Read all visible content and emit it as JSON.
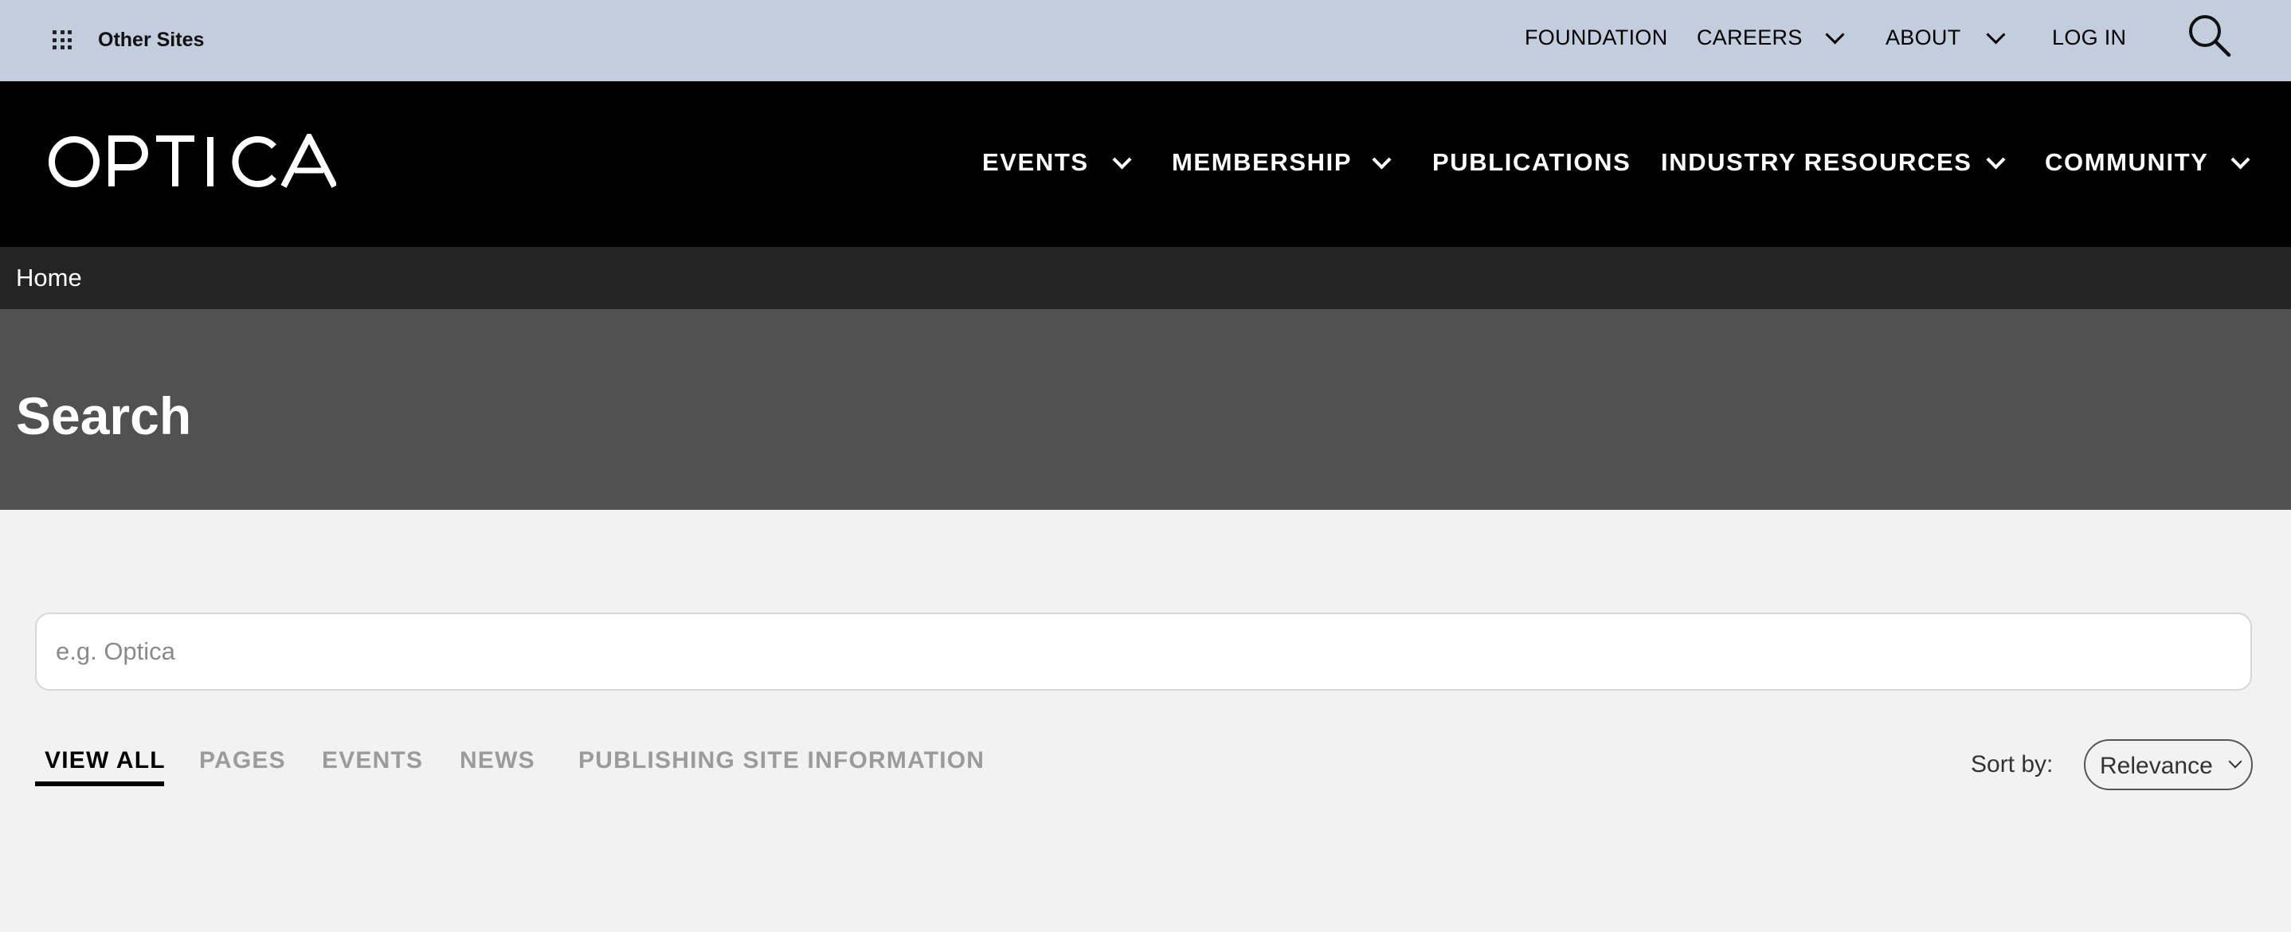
{
  "utility_bar": {
    "other_sites_label": "Other Sites",
    "items": [
      {
        "label": "FOUNDATION",
        "has_dropdown": false
      },
      {
        "label": "CAREERS",
        "has_dropdown": true
      },
      {
        "label": "ABOUT",
        "has_dropdown": true
      },
      {
        "label": "LOG IN",
        "has_dropdown": false
      }
    ],
    "search_icon": "search-icon",
    "background_color": "#c2cede"
  },
  "main_nav": {
    "logo_text": "OPTICA",
    "items": [
      {
        "label": "EVENTS",
        "has_dropdown": true
      },
      {
        "label": "MEMBERSHIP",
        "has_dropdown": true
      },
      {
        "label": "PUBLICATIONS",
        "has_dropdown": false
      },
      {
        "label": "INDUSTRY RESOURCES",
        "has_dropdown": true
      },
      {
        "label": "COMMUNITY",
        "has_dropdown": true
      }
    ],
    "background_color": "#000000"
  },
  "breadcrumb": {
    "items": [
      "Home"
    ]
  },
  "hero": {
    "title": "Search",
    "background_color": "#515151"
  },
  "search": {
    "placeholder": "e.g. Optica",
    "value": ""
  },
  "tabs": [
    {
      "label": "VIEW ALL",
      "active": true
    },
    {
      "label": "PAGES",
      "active": false
    },
    {
      "label": "EVENTS",
      "active": false
    },
    {
      "label": "NEWS",
      "active": false
    },
    {
      "label": "PUBLISHING SITE INFORMATION",
      "active": false
    }
  ],
  "sort": {
    "label": "Sort by:",
    "selected": "Relevance"
  }
}
